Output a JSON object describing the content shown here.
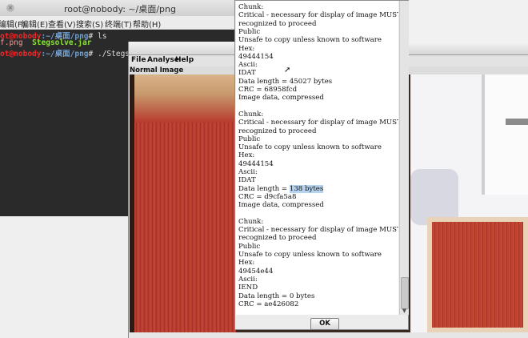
{
  "terminal": {
    "title": "root@nobody: ~/桌面/png",
    "close_glyph": "×",
    "menu": [
      "编辑(F)",
      "编辑(E)",
      "查看(V)",
      "搜索(S)",
      "终端(T)",
      "帮助(H)"
    ],
    "lines": [
      {
        "user": "ot@nobody",
        "path": ":~/桌面/png",
        "cmd": "# ls"
      },
      {
        "file1": "f.png",
        "file2": "Stegsolve.jar"
      },
      {
        "user": "ot@nobody",
        "path": ":~/桌面/png",
        "cmd": "# ./Stegsolve"
      }
    ]
  },
  "stegsolve": {
    "menu": [
      "File",
      "Analyse",
      "Help"
    ],
    "image_label": "Normal Image"
  },
  "dialog": {
    "lines": [
      "Chunk:",
      "Critical - necessary for display of image MUST BE",
      "recognized to proceed",
      "Public",
      "Unsafe to copy unless known to software",
      "Hex:",
      "49444154",
      "Ascii:",
      "IDAT",
      "Data length = 45027 bytes",
      "CRC = 68958fcd",
      "Image data, compressed",
      "",
      "Chunk:",
      "Critical - necessary for display of image MUST BE",
      "recognized to proceed",
      "Public",
      "Unsafe to copy unless known to software",
      "Hex:",
      "49444154",
      "Ascii:",
      "IDAT",
      "Data length = ",
      "CRC = d9cfa5a8",
      "Image data, compressed",
      "",
      "Chunk:",
      "Critical - necessary for display of image MUST BE",
      "recognized to proceed",
      "Public",
      "Unsafe to copy unless known to software",
      "Hex:",
      "49454e44",
      "Ascii:",
      "IEND",
      "Data length = 0 bytes",
      "CRC = ae426082"
    ],
    "highlight_text": "138 bytes",
    "ok_label": "OK"
  }
}
